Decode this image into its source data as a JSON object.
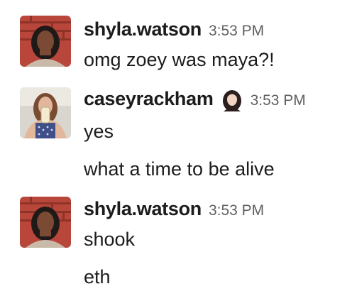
{
  "messages": [
    {
      "author": "shyla.watson",
      "time": "3:53 PM",
      "lines": [
        "omg zoey was maya?!"
      ],
      "avatar": "shyla-avatar"
    },
    {
      "author": "caseyrackham",
      "time": "3:53 PM",
      "status_emoji": "status-portrait-emoji",
      "lines": [
        "yes",
        "what a time to be alive"
      ],
      "avatar": "casey-avatar"
    },
    {
      "author": "shyla.watson",
      "time": "3:53 PM",
      "lines": [
        "shook",
        "eth"
      ],
      "avatar": "shyla-avatar"
    }
  ],
  "colors": {
    "text": "#1d1c1d",
    "timestamp": "#616061",
    "background": "#ffffff"
  }
}
